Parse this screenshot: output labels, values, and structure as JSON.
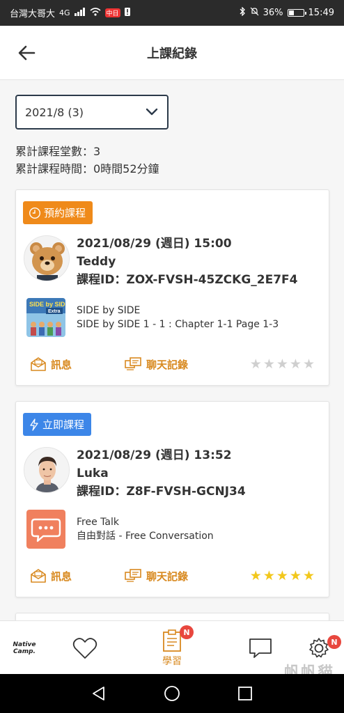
{
  "status_bar": {
    "carrier": "台灣大哥大",
    "network": "4G",
    "notif_badge": "中日",
    "battery_text": "36%",
    "battery_level": 0.36,
    "time": "15:49"
  },
  "header": {
    "title": "上課紀錄",
    "back_icon": "arrow-left-icon"
  },
  "month_select": {
    "value": "2021/8 (3)"
  },
  "summary": {
    "count_line": "累計課程堂數：3",
    "time_line": "累計課程時間：0時間52分鐘"
  },
  "lessons": [
    {
      "badge": "預約課程",
      "badge_icon": "clock-icon",
      "datetime": "2021/08/29 (週日) 15:00",
      "teacher": "Teddy",
      "lesson_id": "課程ID：ZOX-FVSH-45ZCKG_2E7F4",
      "material_title": "SIDE by SIDE",
      "material_detail": "SIDE by SIDE 1 - 1 : Chapter 1-1 Page 1-3",
      "material_icon_text": "SIDE by SIDE",
      "material_icon_sub": "Extra",
      "msg_label": "訊息",
      "chat_label": "聊天記錄",
      "rating": 0
    },
    {
      "badge": "立即課程",
      "badge_icon": "lightning-icon",
      "datetime": "2021/08/29 (週日) 13:52",
      "teacher": "Luka",
      "lesson_id": "課程ID：Z8F-FVSH-GCNJ34",
      "material_title": "Free Talk",
      "material_detail": "自由對話 - Free Conversation",
      "msg_label": "訊息",
      "chat_label": "聊天記錄",
      "rating": 5
    }
  ],
  "bottom_nav": {
    "logo_text": "Native Camp.",
    "study_label": "學習",
    "study_badge": "N",
    "settings_badge": "N",
    "watermark": "帆帆貓"
  },
  "colors": {
    "orange": "#ef8a1a",
    "blue": "#3c86e8",
    "accent_text": "#d8891f",
    "star": "#f2c71b"
  }
}
